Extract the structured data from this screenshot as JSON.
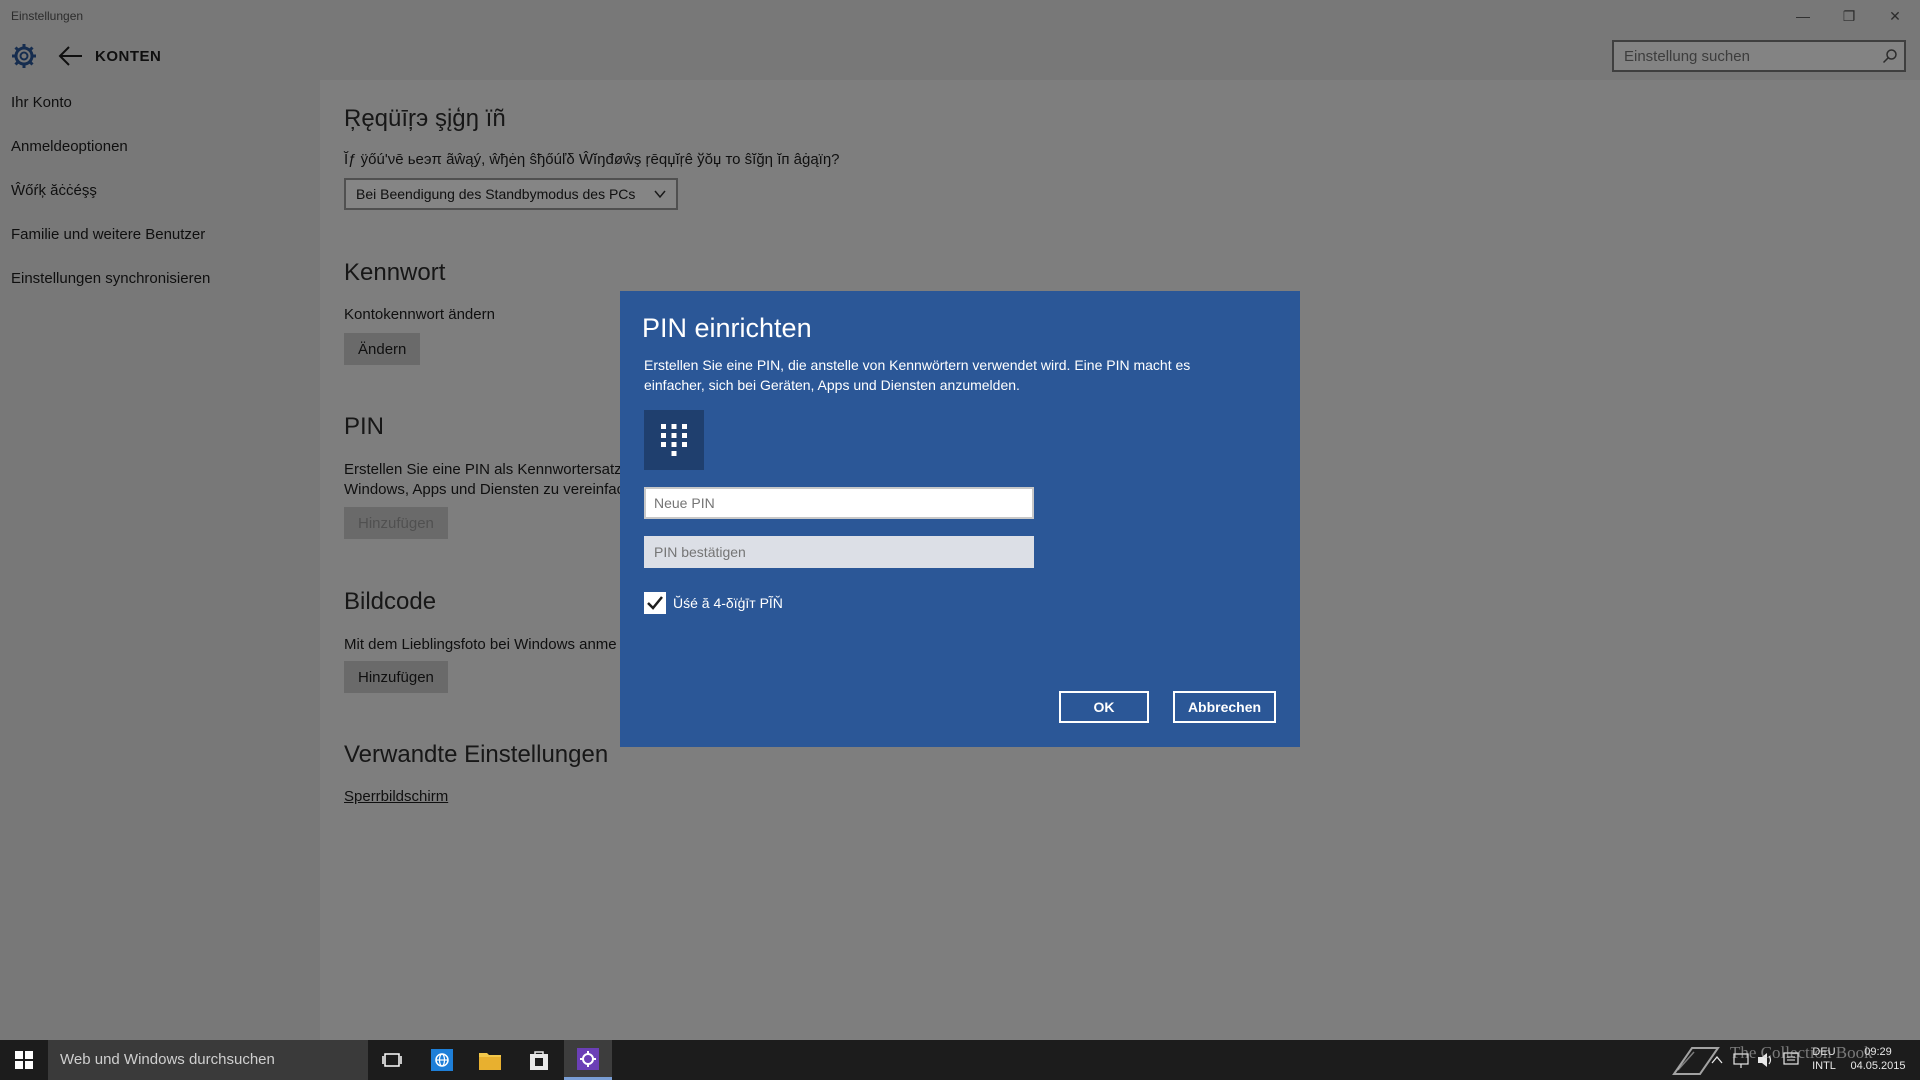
{
  "window": {
    "title": "Einstellungen",
    "minimize": "—",
    "restore": "❐",
    "close": "✕"
  },
  "header": {
    "section": "KONTEN",
    "search_placeholder": "Einstellung suchen"
  },
  "sidebar": {
    "items": [
      {
        "label": "Ihr Konto"
      },
      {
        "label": "Anmeldeoptionen"
      },
      {
        "label": "Ŵőŕķ ăċċéşş"
      },
      {
        "label": "Familie und weitere Benutzer"
      },
      {
        "label": "Einstellungen synchronisieren"
      }
    ]
  },
  "content": {
    "require_signin": {
      "title": "Ŗęqüīŗэ şįģŋ ïñ",
      "question": "Ĭƒ ÿőú'νē ьеэπ ãŵąý, ŵђėη ŝђőúľδ Ŵĭŋđøŵş ŗēqџĭŗê ўŏџ то ŝĭğη ĭп âġąïŋ?",
      "selected": "Bei Beendigung des Standbymodus des PCs"
    },
    "password": {
      "title": "Kennwort",
      "text": "Kontokennwort ändern",
      "button": "Ändern"
    },
    "pin": {
      "title": "PIN",
      "text_line1": "Erstellen Sie eine PIN als Kennwortersatz, u",
      "text_line2": "Windows, Apps und Diensten zu vereinfac",
      "button": "Hinzufügen"
    },
    "picture": {
      "title": "Bildcode",
      "text": "Mit dem Lieblingsfoto bei Windows anme",
      "button": "Hinzufügen"
    },
    "related": {
      "title": "Verwandte Einstellungen",
      "link": "Sperrbildschirm"
    }
  },
  "dialog": {
    "title": "PIN einrichten",
    "description": "Erstellen Sie eine PIN, die anstelle von Kennwörtern verwendet wird. Eine PIN macht es einfacher, sich bei Geräten, Apps und Diensten anzumelden.",
    "new_pin_placeholder": "Neue PIN",
    "confirm_pin_placeholder": "PIN bestätigen",
    "checkbox_label": "Ŭśé ă 4-δïģīт PĨŇ",
    "checkbox_checked": true,
    "ok": "OK",
    "cancel": "Abbrechen"
  },
  "taskbar": {
    "search_placeholder": "Web und Windows durchsuchen",
    "lang_top": "DEU",
    "lang_bottom": "INTL",
    "time": "09:29",
    "date": "04.05.2015"
  },
  "watermark": "The Collection Book",
  "colors": {
    "dialog_bg": "#2b5797",
    "taskbar_bg": "#1c1c1c",
    "accent_active": "#7a9fd6"
  }
}
